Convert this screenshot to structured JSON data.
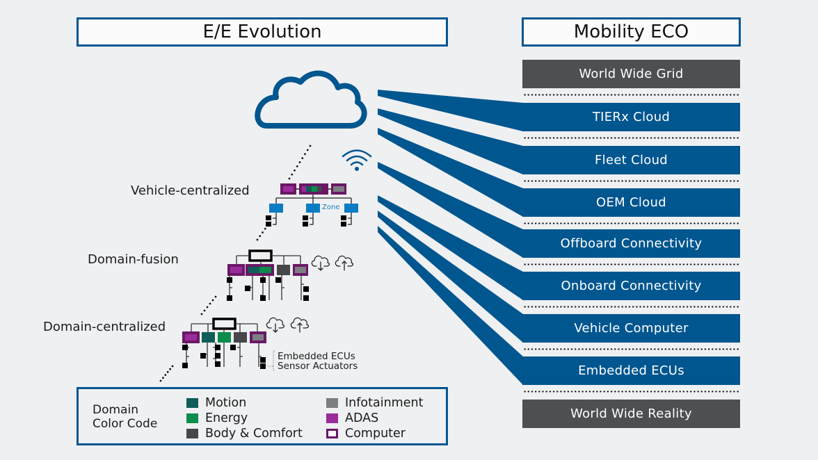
{
  "left_panel": {
    "title": "E/E Evolution",
    "levels": [
      {
        "label": "Vehicle-centralized",
        "zone_label": "Zone"
      },
      {
        "label": "Domain-fusion"
      },
      {
        "label": "Domain-centralized"
      }
    ],
    "annotations": {
      "embedded_ecus": "Embedded ECUs",
      "sensor_actuators": "Sensor Actuators"
    },
    "icons": [
      "cloud-icon",
      "wifi-icon",
      "cloud-download-icon",
      "cloud-upload-icon"
    ]
  },
  "legend": {
    "title_line1": "Domain",
    "title_line2": "Color Code",
    "items": [
      {
        "label": "Motion",
        "color": "#0f5e57"
      },
      {
        "label": "Energy",
        "color": "#0a8c4a"
      },
      {
        "label": "Body & Comfort",
        "color": "#45474b"
      },
      {
        "label": "Infotainment",
        "color": "#7d7f82"
      },
      {
        "label": "ADAS",
        "color": "#9b2b9a"
      },
      {
        "label": "Computer",
        "color": "#6a1866"
      }
    ]
  },
  "right_panel": {
    "title": "Mobility ECO",
    "layers": [
      {
        "label": "World Wide Grid",
        "style": "gray"
      },
      {
        "label": "TIERx Cloud",
        "style": "blue"
      },
      {
        "label": "Fleet Cloud",
        "style": "blue"
      },
      {
        "label": "OEM Cloud",
        "style": "blue"
      },
      {
        "label": "Offboard Connectivity",
        "style": "blue"
      },
      {
        "label": "Onboard Connectivity",
        "style": "blue"
      },
      {
        "label": "Vehicle Computer",
        "style": "blue"
      },
      {
        "label": "Embedded ECUs",
        "style": "blue"
      },
      {
        "label": "World Wide Reality",
        "style": "gray"
      }
    ]
  },
  "colors": {
    "brand_blue": "#00568f",
    "zone_blue": "#0b7cc4",
    "dark_gray": "#4d4f53",
    "background": "#eff0f2"
  }
}
